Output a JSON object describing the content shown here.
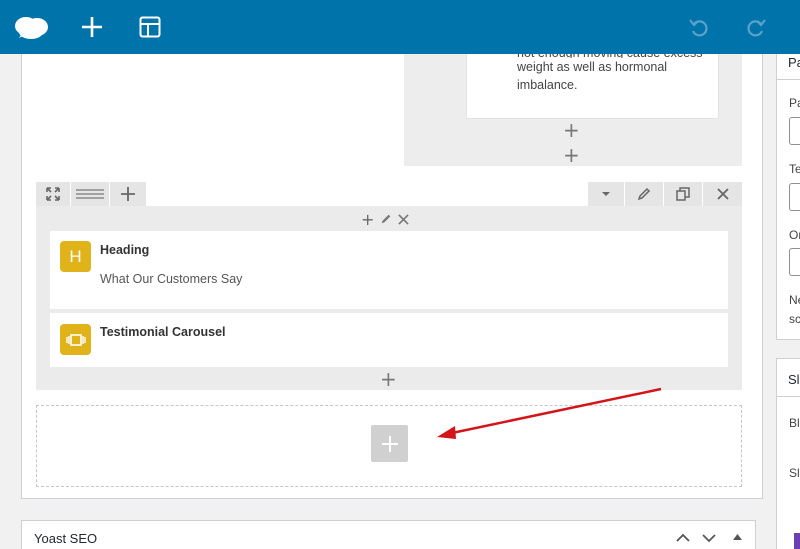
{
  "toolbar": {
    "icons": [
      "cloud-logo-icon",
      "add-icon",
      "layout-icon",
      "undo-icon",
      "redo-icon"
    ],
    "background": "#0073aa"
  },
  "previous_row": {
    "text_partial": "not enough moving cause excess",
    "text_line2": "weight as well as hormonal",
    "text_line3": "imbalance."
  },
  "section_toolbar": {
    "left_icons": [
      "move-icon",
      "drag-handle-icon",
      "add-column-icon"
    ],
    "right_icons": [
      "dropdown-icon",
      "edit-icon",
      "duplicate-icon",
      "close-icon"
    ]
  },
  "modules": [
    {
      "icon_letter": "H",
      "title": "Heading",
      "subtitle": "What Our Customers Say"
    },
    {
      "icon_letter": "",
      "title": "Testimonial Carousel",
      "subtitle": ""
    }
  ],
  "yoast": {
    "title": "Yoast SEO"
  },
  "sidebar": {
    "box1": {
      "heading": "Pa",
      "labels": [
        "Pa",
        "Te",
        "Or",
        "Ne",
        "sc"
      ]
    },
    "box2": {
      "heading": "Sl",
      "labels": [
        "Bl",
        "Sl"
      ]
    }
  },
  "colors": {
    "module_icon": "#e0b31a",
    "annotation_arrow": "#d4141a"
  }
}
